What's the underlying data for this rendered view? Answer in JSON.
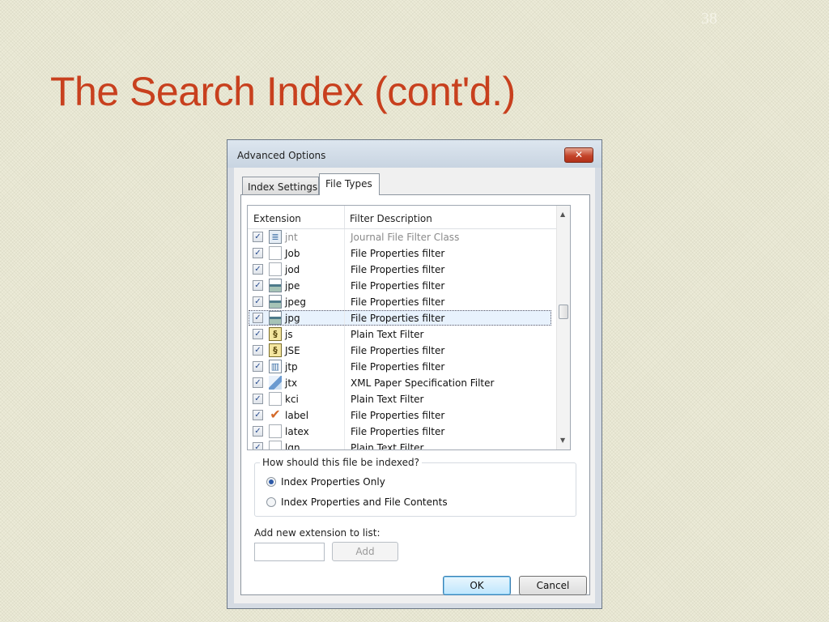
{
  "slide": {
    "number": "38",
    "title": "The Search Index (cont'd.)"
  },
  "dialog": {
    "title": "Advanced Options",
    "close_glyph": "✕",
    "tabs": [
      {
        "label": "Index Settings",
        "active": false
      },
      {
        "label": "File Types",
        "active": true
      }
    ],
    "list": {
      "columns": {
        "extension": "Extension",
        "description": "Filter Description"
      },
      "rows": [
        {
          "ext": "jnt",
          "desc": "Journal File Filter Class",
          "checked": true,
          "icon": "journal-icon",
          "dim": true
        },
        {
          "ext": "Job",
          "desc": "File Properties filter",
          "checked": true,
          "icon": "blank-file-icon"
        },
        {
          "ext": "jod",
          "desc": "File Properties filter",
          "checked": true,
          "icon": "blank-file-icon"
        },
        {
          "ext": "jpe",
          "desc": "File Properties filter",
          "checked": true,
          "icon": "image-file-icon"
        },
        {
          "ext": "jpeg",
          "desc": "File Properties filter",
          "checked": true,
          "icon": "image-file-icon"
        },
        {
          "ext": "jpg",
          "desc": "File Properties filter",
          "checked": true,
          "icon": "image-file-icon",
          "selected": true
        },
        {
          "ext": "js",
          "desc": "Plain Text Filter",
          "checked": true,
          "icon": "script-file-icon"
        },
        {
          "ext": "JSE",
          "desc": "File Properties filter",
          "checked": true,
          "icon": "script-file-icon"
        },
        {
          "ext": "jtp",
          "desc": "File Properties filter",
          "checked": true,
          "icon": "template-file-icon"
        },
        {
          "ext": "jtx",
          "desc": "XML Paper Specification Filter",
          "checked": true,
          "icon": "xps-file-icon"
        },
        {
          "ext": "kci",
          "desc": "Plain Text Filter",
          "checked": true,
          "icon": "blank-file-icon"
        },
        {
          "ext": "label",
          "desc": "File Properties filter",
          "checked": true,
          "icon": "checkmark-file-icon"
        },
        {
          "ext": "latex",
          "desc": "File Properties filter",
          "checked": true,
          "icon": "blank-file-icon"
        },
        {
          "ext": "lgn",
          "desc": "Plain Text Filter",
          "checked": true,
          "icon": "blank-file-icon"
        }
      ],
      "scroll_position": 0.42
    },
    "index_group": {
      "label": "How should this file be indexed?",
      "options": [
        {
          "label": "Index Properties Only",
          "selected": true
        },
        {
          "label": "Index Properties and File Contents",
          "selected": false
        }
      ]
    },
    "add_extension": {
      "label": "Add new extension to list:",
      "value": "",
      "button": "Add"
    },
    "buttons": {
      "ok": "OK",
      "cancel": "Cancel"
    }
  },
  "colors": {
    "title": "#c8401e",
    "background": "#ecebd8",
    "accent": "#2d5aa7"
  }
}
